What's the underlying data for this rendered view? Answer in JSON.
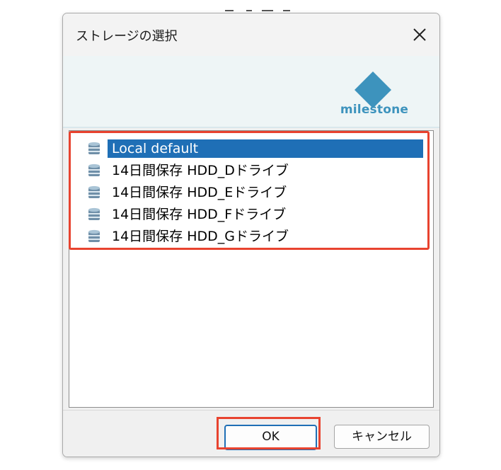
{
  "dialog": {
    "title": "ストレージの選択",
    "logo_text": "milestone",
    "brand_color": "#3d93bd",
    "close_icon": "close-icon"
  },
  "storage_list": {
    "items": [
      {
        "label": "Local default",
        "selected": true,
        "icon": "database-icon"
      },
      {
        "label": "14日間保存 HDD_Dドライブ",
        "selected": false,
        "icon": "database-icon"
      },
      {
        "label": "14日間保存 HDD_Eドライブ",
        "selected": false,
        "icon": "database-icon"
      },
      {
        "label": "14日間保存 HDD_Fドライブ",
        "selected": false,
        "icon": "database-icon"
      },
      {
        "label": "14日間保存 HDD_Gドライブ",
        "selected": false,
        "icon": "database-icon"
      }
    ]
  },
  "buttons": {
    "ok": "OK",
    "cancel": "キャンセル"
  },
  "annotations": {
    "highlight_color": "#e8432f"
  }
}
